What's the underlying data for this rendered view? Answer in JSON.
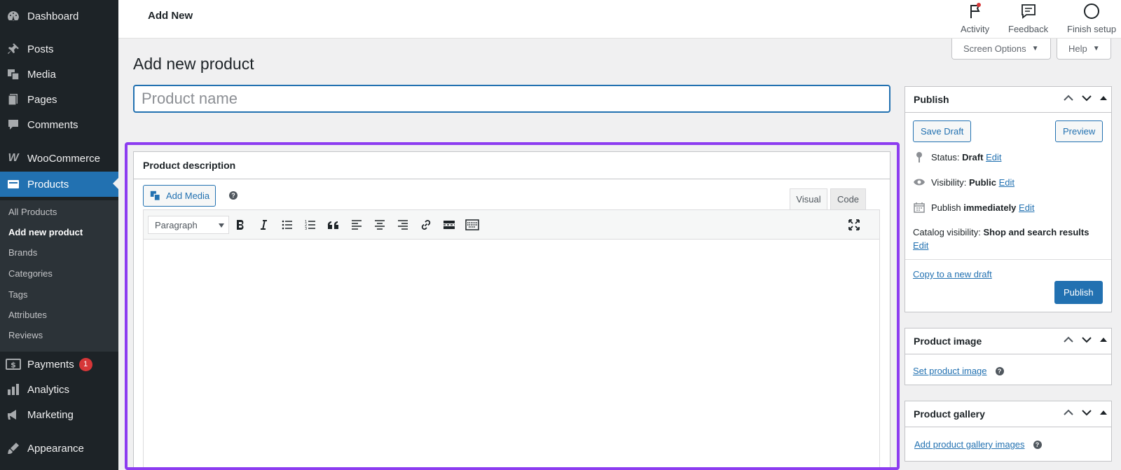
{
  "sidebar": {
    "items": [
      {
        "label": "Dashboard",
        "icon": "dashboard-icon"
      },
      {
        "label": "Posts",
        "icon": "pin-icon"
      },
      {
        "label": "Media",
        "icon": "media-icon"
      },
      {
        "label": "Pages",
        "icon": "pages-icon"
      },
      {
        "label": "Comments",
        "icon": "comments-icon"
      },
      {
        "label": "WooCommerce",
        "icon": "woocommerce-icon"
      },
      {
        "label": "Products",
        "icon": "products-icon"
      },
      {
        "label": "Payments",
        "icon": "payments-icon",
        "badge": "1"
      },
      {
        "label": "Analytics",
        "icon": "analytics-icon"
      },
      {
        "label": "Marketing",
        "icon": "marketing-icon"
      },
      {
        "label": "Appearance",
        "icon": "appearance-icon"
      }
    ],
    "submenu": [
      "All Products",
      "Add new product",
      "Brands",
      "Categories",
      "Tags",
      "Attributes",
      "Reviews"
    ]
  },
  "topbar": {
    "title": "Add New",
    "activity": "Activity",
    "feedback": "Feedback",
    "finish_setup": "Finish setup"
  },
  "screen_options": "Screen Options",
  "help": "Help",
  "page_title": "Add new product",
  "product_name": {
    "placeholder": "Product name",
    "value": ""
  },
  "description": {
    "title": "Product description",
    "add_media": "Add Media",
    "help": "?",
    "tab_visual": "Visual",
    "tab_code": "Code",
    "format": "Paragraph"
  },
  "publish": {
    "title": "Publish",
    "save_draft": "Save Draft",
    "preview": "Preview",
    "status_label": "Status:",
    "status_value": "Draft",
    "visibility_label": "Visibility:",
    "visibility_value": "Public",
    "publish_label": "Publish",
    "publish_value": "immediately",
    "catalog_label": "Catalog visibility:",
    "catalog_value": "Shop and search results",
    "edit": "Edit",
    "copy_draft": "Copy to a new draft",
    "publish_button": "Publish"
  },
  "product_image": {
    "title": "Product image",
    "link": "Set product image"
  },
  "product_gallery": {
    "title": "Product gallery",
    "link": "Add product gallery images"
  },
  "colors": {
    "accent": "#2271b1",
    "highlight": "#8c3cf0",
    "sidebar": "#1d2327"
  }
}
